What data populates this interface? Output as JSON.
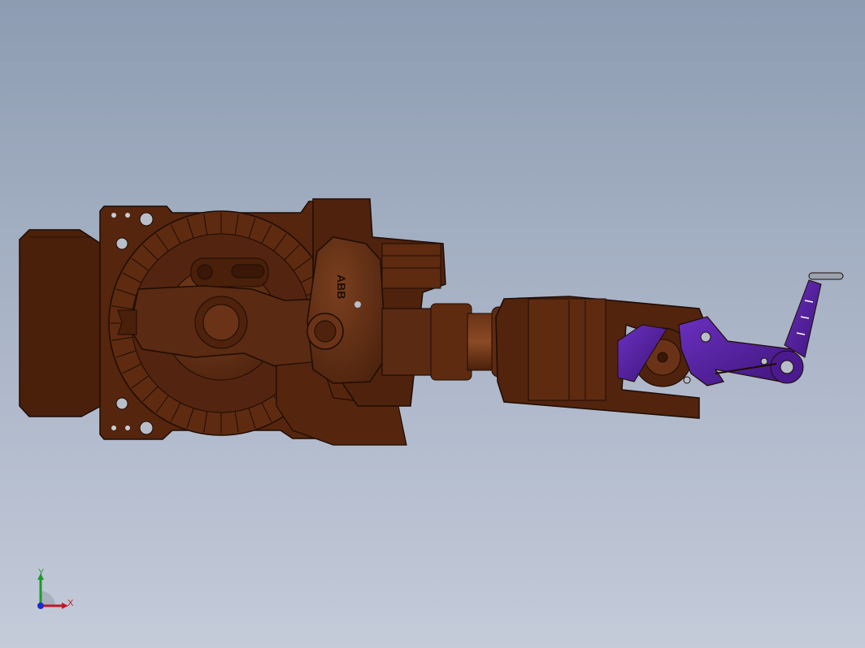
{
  "app": {
    "type": "cad-3d-viewport"
  },
  "model": {
    "name": "industrial-robot-arm",
    "logo_text": "ABB",
    "colors": {
      "body_main": "#5a2a12",
      "body_dark": "#3f1b0a",
      "body_light": "#7a3f1f",
      "edge": "#1e0c04",
      "gripper": "#5a24a8",
      "gripper_dark": "#3d1478",
      "metal": "#9aa2ae"
    }
  },
  "triad": {
    "x_label": "X",
    "y_label": "Y",
    "x_color": "#c0182a",
    "y_color": "#1c9a2a",
    "z_color": "#1a2bd0"
  },
  "background": {
    "top": "#8d9cb2",
    "bottom": "#c4cbd9"
  }
}
